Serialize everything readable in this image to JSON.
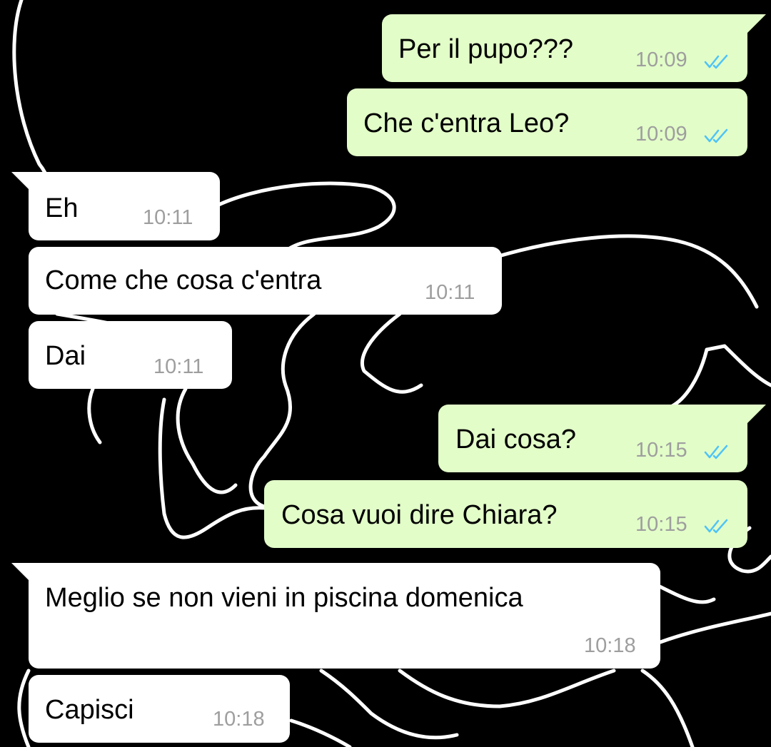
{
  "chat": {
    "messages": [
      {
        "text": "Per il pupo???",
        "time": "10:09",
        "direction": "outgoing",
        "status": "read-double-check-icon"
      },
      {
        "text": "Che c'entra Leo?",
        "time": "10:09",
        "direction": "outgoing",
        "status": "read-double-check-icon"
      },
      {
        "text": "Eh",
        "time": "10:11",
        "direction": "incoming"
      },
      {
        "text": "Come che cosa c'entra",
        "time": "10:11",
        "direction": "incoming"
      },
      {
        "text": "Dai",
        "time": "10:11",
        "direction": "incoming"
      },
      {
        "text": "Dai cosa?",
        "time": "10:15",
        "direction": "outgoing",
        "status": "read-double-check-icon"
      },
      {
        "text": "Cosa vuoi dire Chiara?",
        "time": "10:15",
        "direction": "outgoing",
        "status": "read-double-check-icon"
      },
      {
        "text": "Meglio se non vieni in piscina domenica",
        "time": "10:18",
        "direction": "incoming"
      },
      {
        "text": "Capisci",
        "time": "10:18",
        "direction": "incoming"
      }
    ]
  },
  "colors": {
    "background": "#000000",
    "wallpaper_lines": "#ffffff",
    "outgoing_bubble": "#e2fdc8",
    "incoming_bubble": "#ffffff",
    "timestamp": "#9e9e9e",
    "read_ticks": "#4fc3f7"
  }
}
